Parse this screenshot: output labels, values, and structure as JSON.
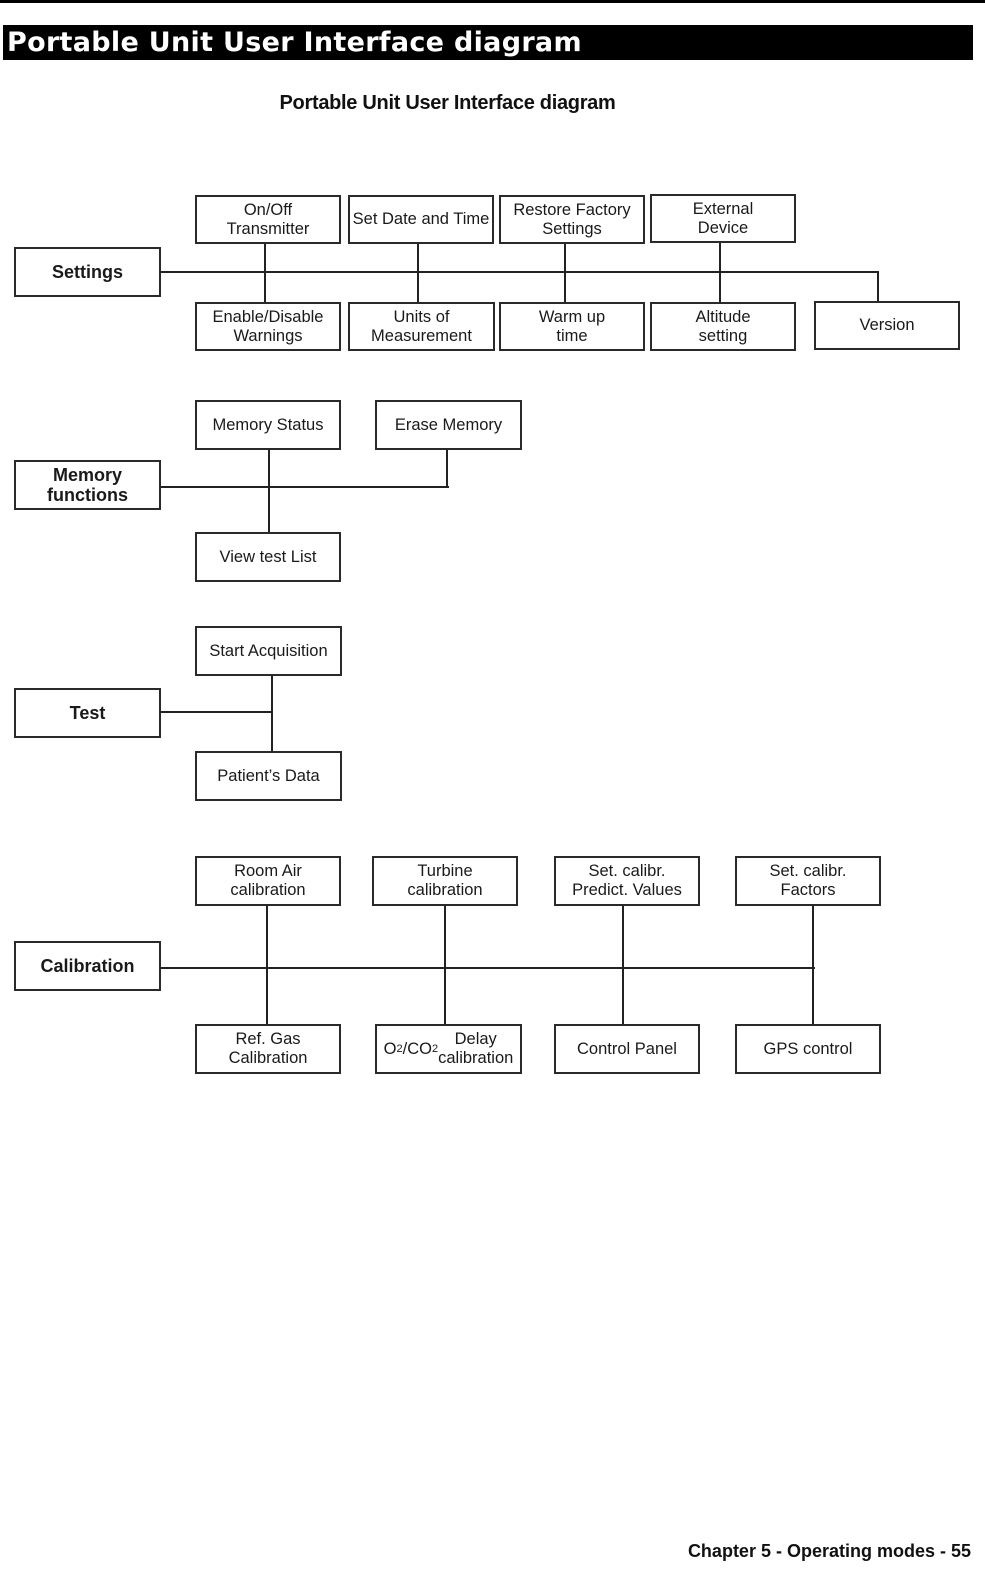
{
  "page": {
    "banner_title": "Portable Unit User Interface diagram",
    "diagram_title": "Portable Unit User Interface diagram",
    "footer": "Chapter 5 - Operating modes - 55"
  },
  "sections": {
    "settings": {
      "label": "Settings",
      "top": [
        "On/Off\nTransmitter",
        "Set Date and Time",
        "Restore Factory\nSettings",
        "External\nDevice"
      ],
      "bottom": [
        "Enable/Disable\nWarnings",
        "Units of\nMeasurement",
        "Warm up\ntime",
        "Altitude\nsetting",
        "Version"
      ]
    },
    "memory": {
      "label": "Memory\nfunctions",
      "top": [
        "Memory Status",
        "Erase Memory"
      ],
      "bottom": [
        "View test List"
      ]
    },
    "test": {
      "label": "Test",
      "top": [
        "Start Acquisition"
      ],
      "bottom": [
        "Patient’s Data"
      ]
    },
    "calibration": {
      "label": "Calibration",
      "top": [
        "Room Air\ncalibration",
        "Turbine\ncalibration",
        "Set. calibr.\nPredict. Values",
        "Set. calibr.\nFactors"
      ],
      "bottom": [
        "Ref. Gas\nCalibration",
        "O2/CO2 Delay\ncalibration",
        "Control Panel",
        "GPS control"
      ]
    }
  }
}
